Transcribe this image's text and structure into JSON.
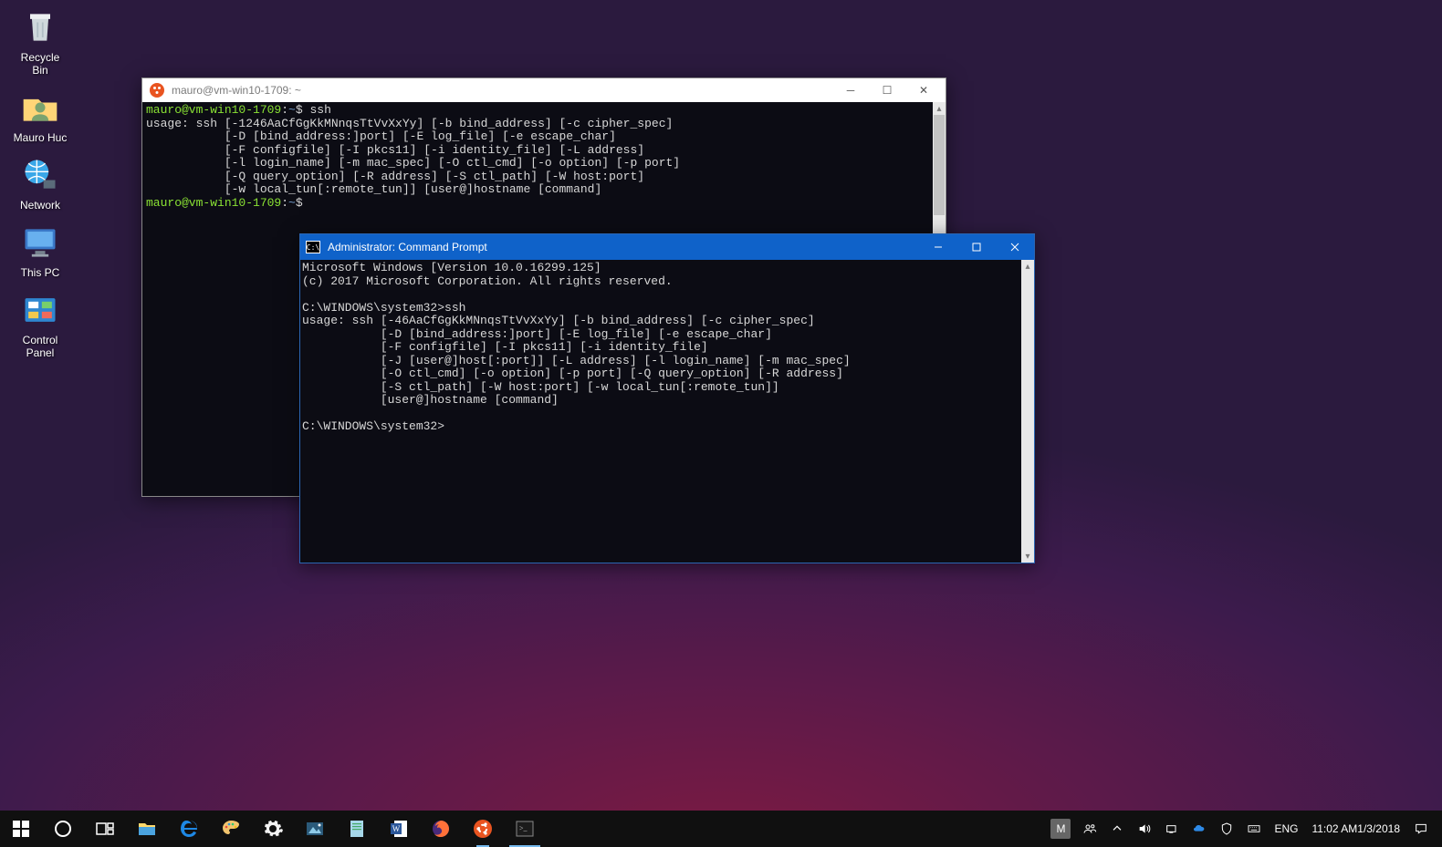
{
  "desktop_icons": [
    {
      "id": "recycle-bin",
      "label": "Recycle\nBin"
    },
    {
      "id": "user-folder",
      "label": "Mauro Huc"
    },
    {
      "id": "network",
      "label": "Network"
    },
    {
      "id": "this-pc",
      "label": "This PC"
    },
    {
      "id": "control-panel",
      "label": "Control\nPanel"
    }
  ],
  "ubuntu_window": {
    "title": "mauro@vm-win10-1709: ~",
    "prompt_user": "mauro@vm-win10-1709",
    "prompt_path": "~",
    "cmd1": "ssh",
    "usage_lines": [
      "usage: ssh [-1246AaCfGgKkMNnqsTtVvXxYy] [-b bind_address] [-c cipher_spec]",
      "           [-D [bind_address:]port] [-E log_file] [-e escape_char]",
      "           [-F configfile] [-I pkcs11] [-i identity_file] [-L address]",
      "           [-l login_name] [-m mac_spec] [-O ctl_cmd] [-o option] [-p port]",
      "           [-Q query_option] [-R address] [-S ctl_path] [-W host:port]",
      "           [-w local_tun[:remote_tun]] [user@]hostname [command]"
    ]
  },
  "cmd_window": {
    "title": "Administrator: Command Prompt",
    "lines_header": [
      "Microsoft Windows [Version 10.0.16299.125]",
      "(c) 2017 Microsoft Corporation. All rights reserved.",
      ""
    ],
    "prompt1": "C:\\WINDOWS\\system32>",
    "cmd1": "ssh",
    "usage_lines": [
      "usage: ssh [-46AaCfGgKkMNnqsTtVvXxYy] [-b bind_address] [-c cipher_spec]",
      "           [-D [bind_address:]port] [-E log_file] [-e escape_char]",
      "           [-F configfile] [-I pkcs11] [-i identity_file]",
      "           [-J [user@]host[:port]] [-L address] [-l login_name] [-m mac_spec]",
      "           [-O ctl_cmd] [-o option] [-p port] [-Q query_option] [-R address]",
      "           [-S ctl_path] [-W host:port] [-w local_tun[:remote_tun]]",
      "           [user@]hostname [command]",
      ""
    ],
    "prompt2": "C:\\WINDOWS\\system32>"
  },
  "taskbar": {
    "apps": [
      {
        "id": "start",
        "name": "start-button"
      },
      {
        "id": "cortana",
        "name": "cortana-button"
      },
      {
        "id": "taskview",
        "name": "task-view-button"
      },
      {
        "id": "explorer",
        "name": "file-explorer"
      },
      {
        "id": "edge",
        "name": "edge-browser"
      },
      {
        "id": "paint",
        "name": "paint-app"
      },
      {
        "id": "settings",
        "name": "settings-app"
      },
      {
        "id": "photos",
        "name": "photos-app"
      },
      {
        "id": "notepad",
        "name": "notepad-app"
      },
      {
        "id": "word",
        "name": "word-app"
      },
      {
        "id": "firefox",
        "name": "firefox-browser"
      },
      {
        "id": "ubuntu",
        "name": "ubuntu-terminal",
        "running": true
      },
      {
        "id": "cmd",
        "name": "command-prompt",
        "active": true
      }
    ],
    "tray": {
      "user_badge": "M",
      "lang": "ENG",
      "time": "11:02 AM",
      "date": "1/3/2018"
    }
  }
}
